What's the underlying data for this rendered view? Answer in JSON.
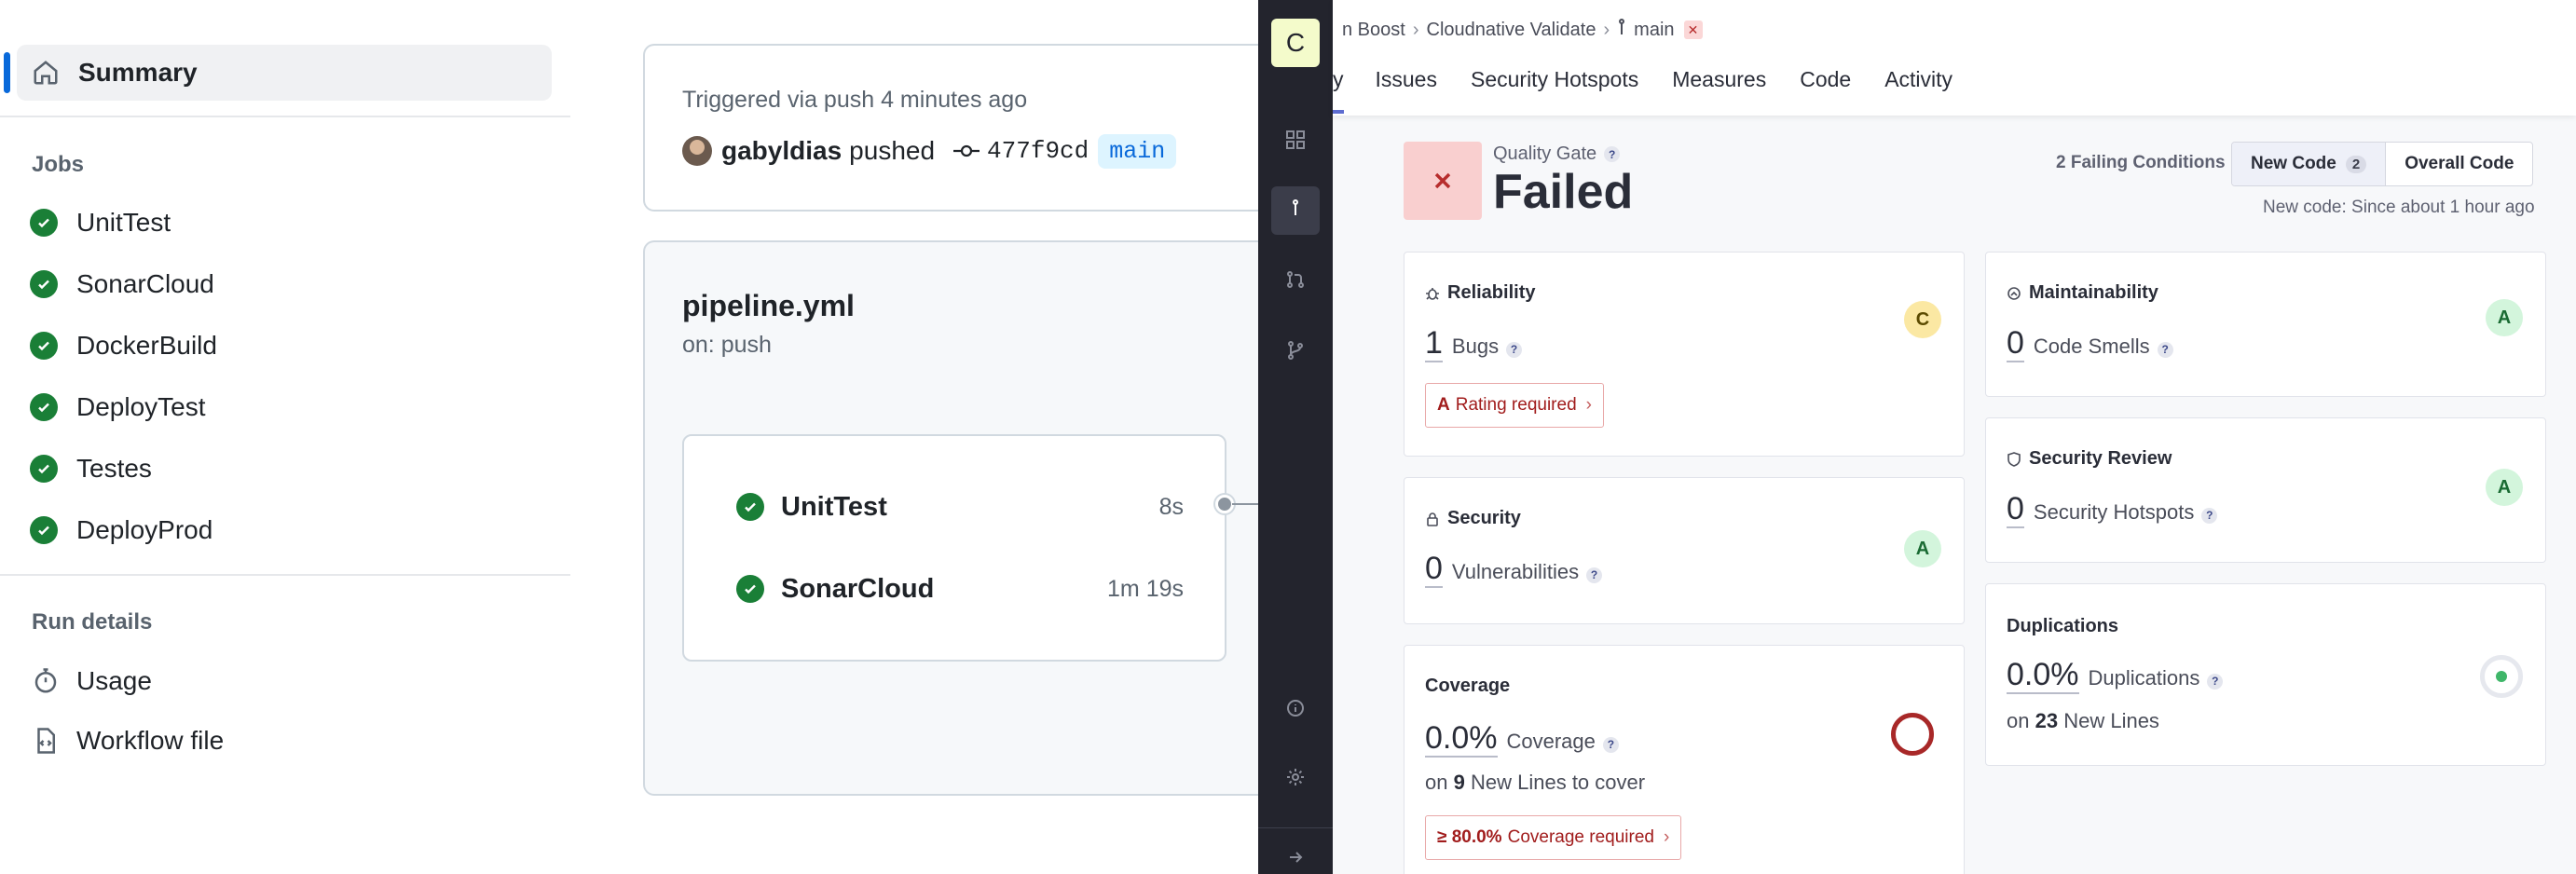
{
  "github": {
    "nav": {
      "summary": "Summary"
    },
    "jobs_title": "Jobs",
    "jobs": [
      "UnitTest",
      "SonarCloud",
      "DockerBuild",
      "DeployTest",
      "Testes",
      "DeployProd"
    ],
    "run_details_title": "Run details",
    "run_details": {
      "usage": "Usage",
      "workflow_file": "Workflow file"
    },
    "trigger": {
      "text": "Triggered via push 4 minutes ago",
      "user": "gabyldias",
      "verb": "pushed",
      "sha": "477f9cd",
      "branch": "main"
    },
    "pipeline": {
      "title": "pipeline.yml",
      "subtitle": "on: push",
      "jobs": [
        {
          "name": "UnitTest",
          "duration": "8s"
        },
        {
          "name": "SonarCloud",
          "duration": "1m 19s"
        }
      ]
    },
    "colors": {
      "success": "#1a7f37",
      "accent": "#0969da"
    }
  },
  "sonar": {
    "logo_letter": "C",
    "breadcrumb": {
      "project": "n Boost",
      "repo": "Cloudnative Validate",
      "branch": "main"
    },
    "tabs": {
      "overview": "y",
      "issues": "Issues",
      "hotspots": "Security Hotspots",
      "measures": "Measures",
      "code": "Code",
      "activity": "Activity"
    },
    "quality_gate": {
      "label": "Quality Gate",
      "status": "Failed",
      "help": "?"
    },
    "failing_conditions": "2 Failing Conditions",
    "toggle": {
      "new_code": "New Code",
      "new_code_count": "2",
      "overall_code": "Overall Code"
    },
    "new_code_since": "New code: Since about 1 hour ago",
    "reliability": {
      "title": "Reliability",
      "value": "1",
      "metric": "Bugs",
      "rating": "C",
      "requirement_grade": "A",
      "requirement_text": "Rating required"
    },
    "maintainability": {
      "title": "Maintainability",
      "value": "0",
      "metric": "Code Smells",
      "rating": "A"
    },
    "security": {
      "title": "Security",
      "value": "0",
      "metric": "Vulnerabilities",
      "rating": "A"
    },
    "security_review": {
      "title": "Security Review",
      "value": "0",
      "metric": "Security Hotspots",
      "rating": "A"
    },
    "coverage": {
      "title": "Coverage",
      "value": "0.0%",
      "metric": "Coverage",
      "on_prefix": "on",
      "lines": "9",
      "lines_suffix": "New Lines to cover",
      "requirement_grade": "≥ 80.0%",
      "requirement_text": "Coverage required"
    },
    "duplications": {
      "title": "Duplications",
      "value": "0.0%",
      "metric": "Duplications",
      "on_prefix": "on",
      "lines": "23",
      "lines_suffix": "New Lines"
    },
    "colors": {
      "failed_bg": "#f9cfcf",
      "failed": "#b72c2c",
      "rating_a": "#d3f5dc",
      "rating_c": "#fbe8a3",
      "rail": "#23242d"
    }
  }
}
